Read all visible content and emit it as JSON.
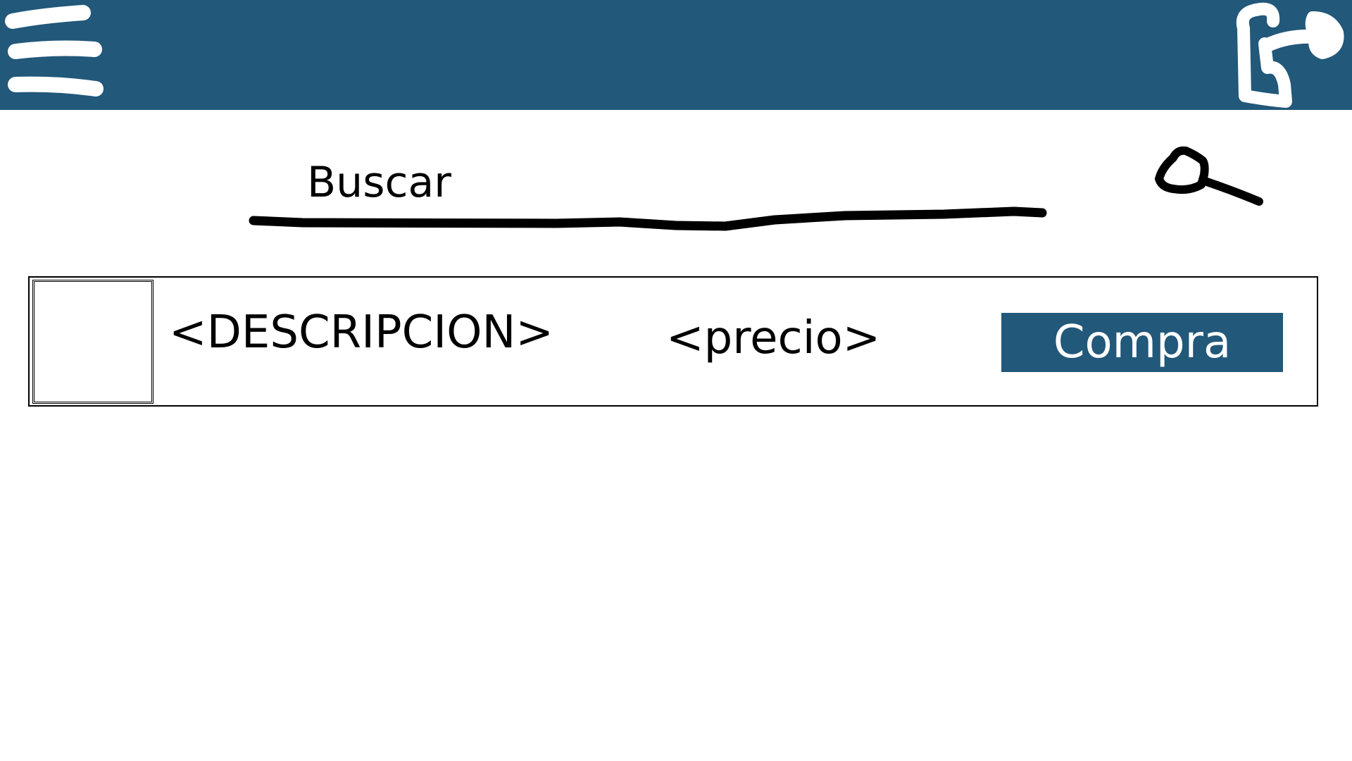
{
  "theme": {
    "header_color": "#22587a",
    "text_color": "#000000",
    "button_text_color": "#ffffff"
  },
  "header": {
    "menu_icon": "hamburger-menu-icon",
    "logout_icon": "logout-exit-icon"
  },
  "search": {
    "placeholder": "Buscar",
    "value": "",
    "icon": "magnifier-search-icon"
  },
  "products": [
    {
      "image_icon": "product-image-placeholder",
      "description": "<DESCRIPCION>",
      "price": "<precio>",
      "buy_label": "Compra"
    }
  ]
}
